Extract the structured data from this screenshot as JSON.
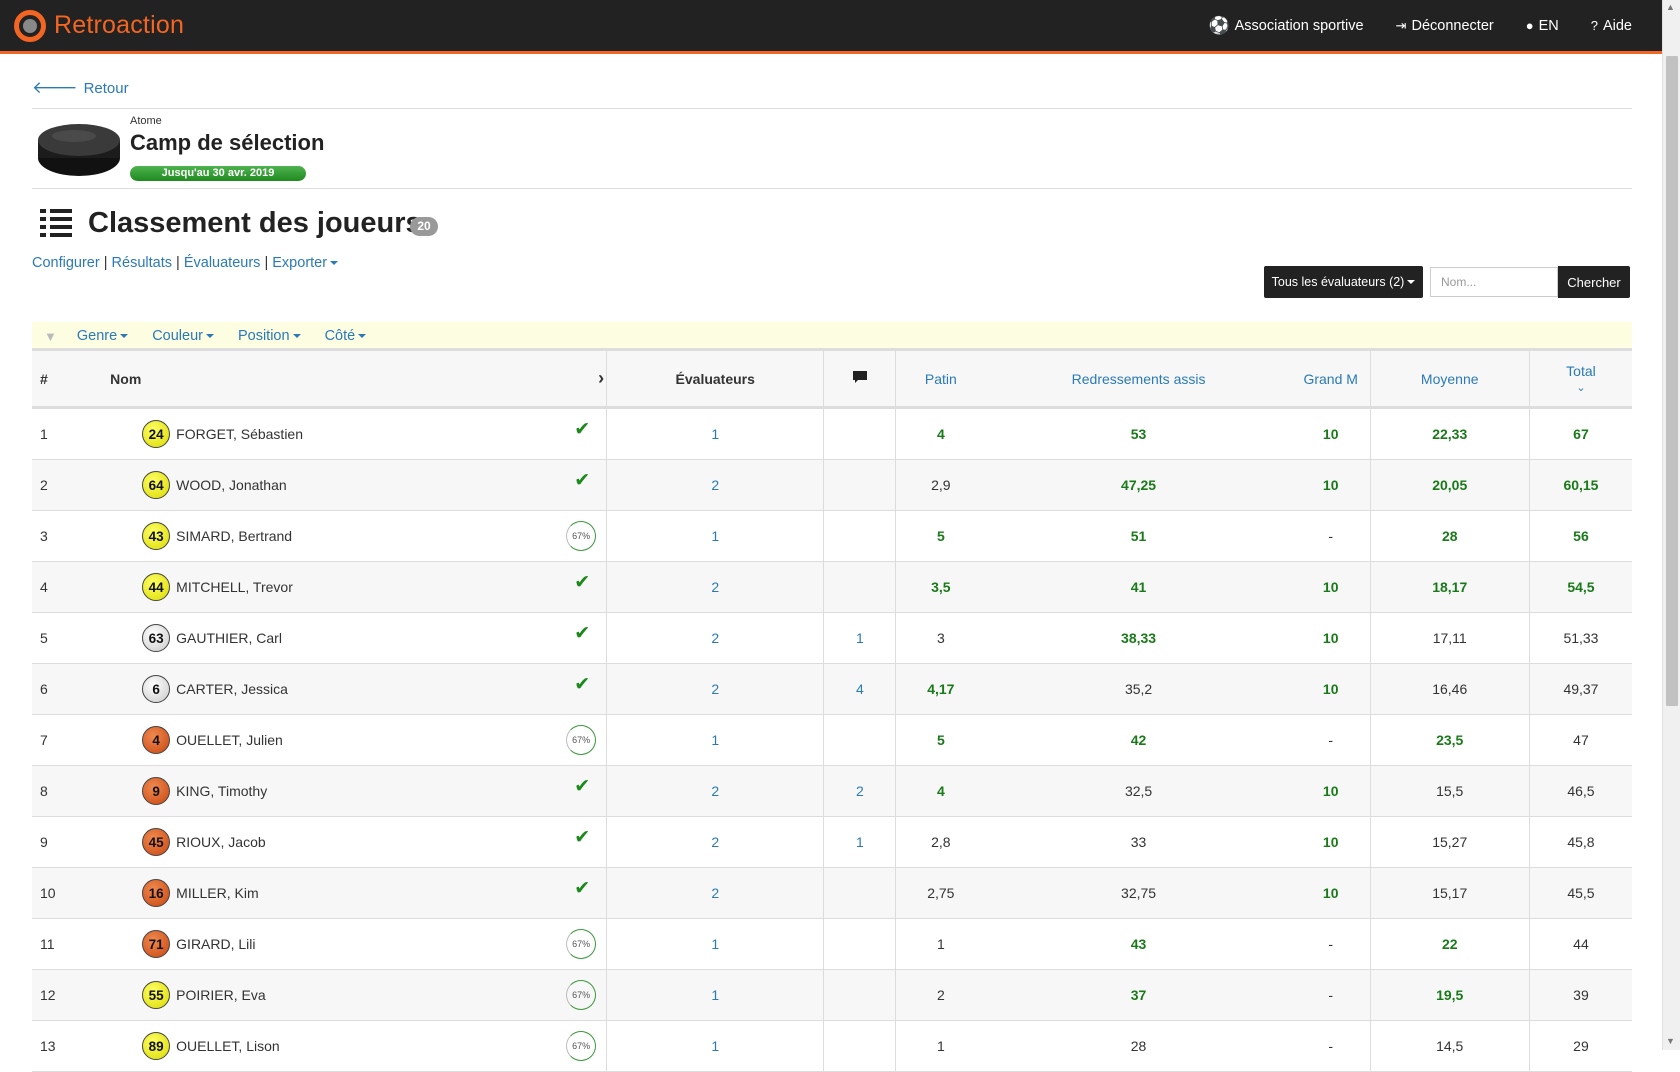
{
  "app": {
    "name": "Retroaction"
  },
  "topnav": {
    "association": "Association sportive",
    "logout": "Déconnecter",
    "lang": "EN",
    "help": "Aide"
  },
  "back": {
    "label": "Retour"
  },
  "event": {
    "category": "Atome",
    "title": "Camp de sélection",
    "badge": "Jusqu'au 30 avr. 2019"
  },
  "page": {
    "title": "Classement des joueurs",
    "count": "20"
  },
  "sublinks": {
    "configure": "Configurer",
    "results": "Résultats",
    "evaluators": "Évaluateurs",
    "export": "Exporter",
    "sep": "|"
  },
  "toolbar": {
    "evaluator_filter": "Tous les évaluateurs (2)",
    "search_placeholder": "Nom...",
    "search_button": "Chercher"
  },
  "filters": {
    "gender": "Genre",
    "color": "Couleur",
    "position": "Position",
    "side": "Côté"
  },
  "table": {
    "headers": {
      "rank": "#",
      "name": "Nom",
      "evaluators": "Évaluateurs",
      "patin": "Patin",
      "redressements": "Redressements assis",
      "grand_m": "Grand M",
      "moyenne": "Moyenne",
      "total": "Total"
    },
    "rows": [
      {
        "rank": "1",
        "num": "24",
        "color": "yellow",
        "name": "FORGET, Sébastien",
        "status": "check",
        "evaluators": "1",
        "comments": "",
        "patin": "4",
        "patin_s": "g1",
        "redr": "53",
        "redr_s": "g3",
        "grand": "10",
        "grand_s": "g3",
        "moy": "22,33",
        "moy_s": "g1",
        "total": "67",
        "total_s": "g2"
      },
      {
        "rank": "2",
        "num": "64",
        "color": "yellow",
        "name": "WOOD, Jonathan",
        "status": "check",
        "evaluators": "2",
        "comments": "",
        "patin": "2,9",
        "patin_s": "plain",
        "redr": "47,25",
        "redr_s": "g1",
        "grand": "10",
        "grand_s": "g3",
        "moy": "20,05",
        "moy_s": "g1",
        "total": "60,15",
        "total_s": "g1"
      },
      {
        "rank": "3",
        "num": "43",
        "color": "yellow",
        "name": "SIMARD, Bertrand",
        "status": "67%",
        "evaluators": "1",
        "comments": "",
        "patin": "5",
        "patin_s": "g2",
        "redr": "51",
        "redr_s": "g1",
        "grand": "-",
        "grand_s": "plain",
        "moy": "28",
        "moy_s": "g2",
        "total": "56",
        "total_s": "g1"
      },
      {
        "rank": "4",
        "num": "44",
        "color": "yellow",
        "name": "MITCHELL, Trevor",
        "status": "check",
        "evaluators": "2",
        "comments": "",
        "patin": "3,5",
        "patin_s": "g1",
        "redr": "41",
        "redr_s": "g1",
        "grand": "10",
        "grand_s": "g3",
        "moy": "18,17",
        "moy_s": "g1",
        "total": "54,5",
        "total_s": "g1"
      },
      {
        "rank": "5",
        "num": "63",
        "color": "white",
        "name": "GAUTHIER, Carl",
        "status": "check",
        "evaluators": "2",
        "comments": "1",
        "patin": "3",
        "patin_s": "plain",
        "redr": "38,33",
        "redr_s": "g1",
        "grand": "10",
        "grand_s": "g3",
        "moy": "17,11",
        "moy_s": "plain",
        "total": "51,33",
        "total_s": "plain"
      },
      {
        "rank": "6",
        "num": "6",
        "color": "white",
        "name": "CARTER, Jessica",
        "status": "check",
        "evaluators": "2",
        "comments": "4",
        "patin": "4,17",
        "patin_s": "g1",
        "redr": "35,2",
        "redr_s": "plain",
        "grand": "10",
        "grand_s": "g3",
        "moy": "16,46",
        "moy_s": "plain",
        "total": "49,37",
        "total_s": "plain"
      },
      {
        "rank": "7",
        "num": "4",
        "color": "orange",
        "name": "OUELLET, Julien",
        "status": "67%",
        "evaluators": "1",
        "comments": "",
        "patin": "5",
        "patin_s": "g2",
        "redr": "42",
        "redr_s": "g1",
        "grand": "-",
        "grand_s": "plain",
        "moy": "23,5",
        "moy_s": "g1",
        "total": "47",
        "total_s": "plain"
      },
      {
        "rank": "8",
        "num": "9",
        "color": "orange",
        "name": "KING, Timothy",
        "status": "check",
        "evaluators": "2",
        "comments": "2",
        "patin": "4",
        "patin_s": "g1",
        "redr": "32,5",
        "redr_s": "plain",
        "grand": "10",
        "grand_s": "g3",
        "moy": "15,5",
        "moy_s": "plain",
        "total": "46,5",
        "total_s": "plain"
      },
      {
        "rank": "9",
        "num": "45",
        "color": "orange",
        "name": "RIOUX, Jacob",
        "status": "check",
        "evaluators": "2",
        "comments": "1",
        "patin": "2,8",
        "patin_s": "plain",
        "redr": "33",
        "redr_s": "plain",
        "grand": "10",
        "grand_s": "g3",
        "moy": "15,27",
        "moy_s": "plain",
        "total": "45,8",
        "total_s": "plain"
      },
      {
        "rank": "10",
        "num": "16",
        "color": "orange",
        "name": "MILLER, Kim",
        "status": "check",
        "evaluators": "2",
        "comments": "",
        "patin": "2,75",
        "patin_s": "plain",
        "redr": "32,75",
        "redr_s": "plain",
        "grand": "10",
        "grand_s": "g3",
        "moy": "15,17",
        "moy_s": "plain",
        "total": "45,5",
        "total_s": "plain"
      },
      {
        "rank": "11",
        "num": "71",
        "color": "orange",
        "name": "GIRARD, Lili",
        "status": "67%",
        "evaluators": "1",
        "comments": "",
        "patin": "1",
        "patin_s": "plain",
        "redr": "43",
        "redr_s": "g1",
        "grand": "-",
        "grand_s": "plain",
        "moy": "22",
        "moy_s": "g1",
        "total": "44",
        "total_s": "plain"
      },
      {
        "rank": "12",
        "num": "55",
        "color": "yellow",
        "name": "POIRIER, Eva",
        "status": "67%",
        "evaluators": "1",
        "comments": "",
        "patin": "2",
        "patin_s": "plain",
        "redr": "37",
        "redr_s": "g1",
        "grand": "-",
        "grand_s": "plain",
        "moy": "19,5",
        "moy_s": "g1",
        "total": "39",
        "total_s": "plain"
      },
      {
        "rank": "13",
        "num": "89",
        "color": "yellow",
        "name": "OUELLET, Lison",
        "status": "67%",
        "evaluators": "1",
        "comments": "",
        "patin": "1",
        "patin_s": "plain",
        "redr": "28",
        "redr_s": "plain",
        "grand": "-",
        "grand_s": "plain",
        "moy": "14,5",
        "moy_s": "plain",
        "total": "29",
        "total_s": "plain"
      }
    ]
  },
  "colors": {
    "accent": "#f26522",
    "link": "#2a7ab8",
    "good": "#1a7a1a",
    "topbar": "#222222"
  }
}
